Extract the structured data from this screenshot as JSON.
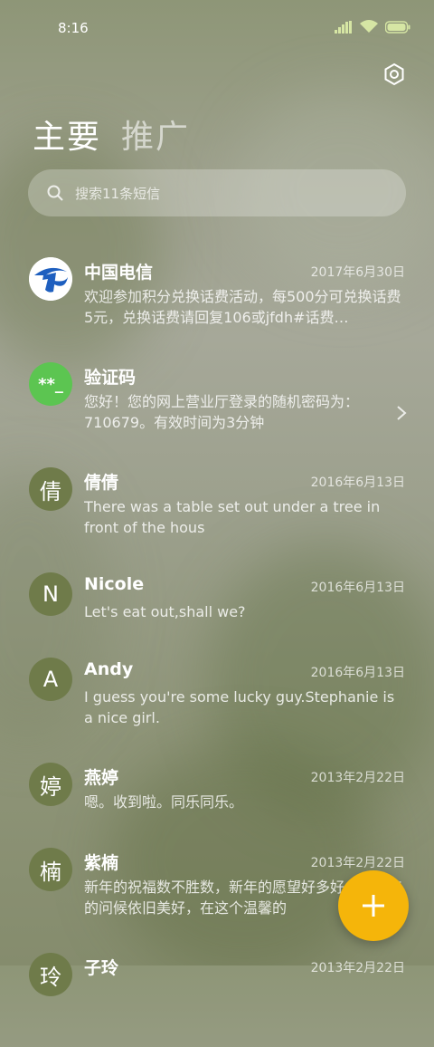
{
  "status": {
    "time": "8:16"
  },
  "header": {
    "tabs": [
      {
        "label": "主要",
        "active": true
      },
      {
        "label": "推广",
        "active": false
      }
    ]
  },
  "search": {
    "placeholder": "搜索11条短信"
  },
  "messages": [
    {
      "name": "中国电信",
      "date": "2017年6月30日",
      "preview": "欢迎参加积分兑换话费活动，每500分可兑换话费5元，兑换话费请回复106或jfdh#话费…",
      "avatar": "logo",
      "avatar_color": "#ffffff"
    },
    {
      "name": "验证码",
      "date": "",
      "preview": "您好！您的网上营业厅登录的随机密码为：710679。有效时间为3分钟",
      "avatar": "**_",
      "avatar_color": "#5cc551"
    },
    {
      "name": "倩倩",
      "date": "2016年6月13日",
      "preview": "There was a table set out under a tree in front of the hous",
      "avatar": "倩",
      "avatar_color": "#6f7b4a"
    },
    {
      "name": "Nicole",
      "date": "2016年6月13日",
      "preview": "Let's eat out,shall we?",
      "avatar": "N",
      "avatar_color": "#6f7b4a"
    },
    {
      "name": "Andy",
      "date": "2016年6月13日",
      "preview": "I guess you're some lucky guy.Stephanie is a nice girl.",
      "avatar": "A",
      "avatar_color": "#6f7b4a"
    },
    {
      "name": "燕婷",
      "date": "2013年2月22日",
      "preview": "嗯。收到啦。同乐同乐。",
      "avatar": "婷",
      "avatar_color": "#6f7b4a"
    },
    {
      "name": "紫楠",
      "date": "2013年2月22日",
      "preview": "新年的祝福数不胜数，新年的愿望好多好多，新年的问候依旧美好，在这个温馨的",
      "avatar": "楠",
      "avatar_color": "#6f7b4a"
    },
    {
      "name": "子玲",
      "date": "2013年2月22日",
      "preview": "",
      "avatar": "玲",
      "avatar_color": "#6f7b4a"
    }
  ],
  "colors": {
    "fab": "#f5b50a",
    "avatar_default": "#6f7b4a",
    "verify_green": "#5cc551"
  },
  "icons": {
    "fab": "plus-icon",
    "settings": "gear-icon",
    "search": "search-icon"
  }
}
